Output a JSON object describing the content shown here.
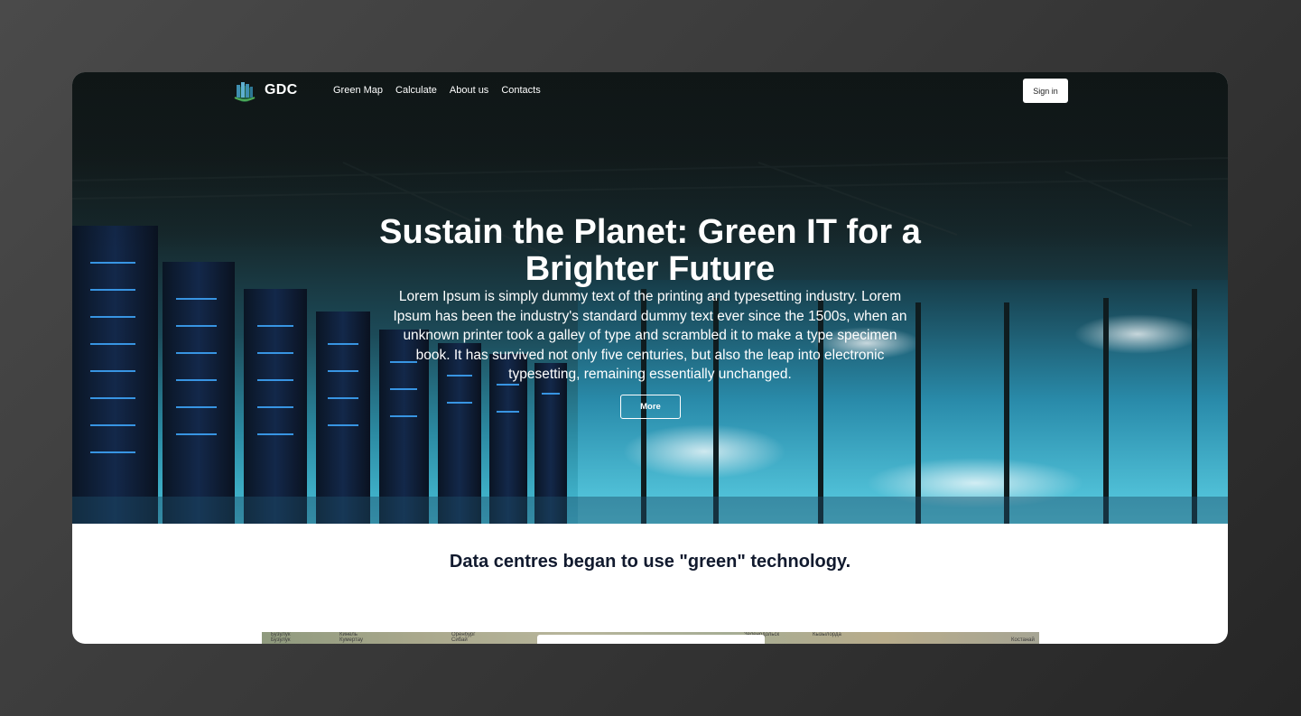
{
  "brand": {
    "name": "GDC",
    "logo_icon": "data-center-logo-icon"
  },
  "nav": {
    "items": [
      "Green Map",
      "Calculate",
      "About us",
      "Contacts"
    ],
    "signin_label": "Sign in"
  },
  "hero": {
    "title": "Sustain the Planet: Green IT for a Brighter Future",
    "description": "Lorem Ipsum is simply dummy text of the printing and typesetting industry. Lorem Ipsum has been the industry's standard dummy text ever since the 1500s, when an unknown printer took a galley of type and scrambled it to make a type specimen book. It has survived not only five centuries, but also the leap into electronic typesetting, remaining essentially unchanged.",
    "button_label": "More"
  },
  "section": {
    "heading": "Data centres began to use \"green\" technology."
  },
  "map": {
    "labels": [
      "Бузулук",
      "Бузулук",
      "Кинель",
      "Кумертау",
      "Оренбург",
      "Сибай",
      "Зеленодольск",
      "Кызылорда",
      "Костанай"
    ]
  },
  "colors": {
    "page_background": "#3a3a3a",
    "hero_dark": "#131c1d",
    "hero_cyan": "#47c0d8",
    "heading_text": "#111a2e",
    "button_bg": "#ffffff"
  }
}
